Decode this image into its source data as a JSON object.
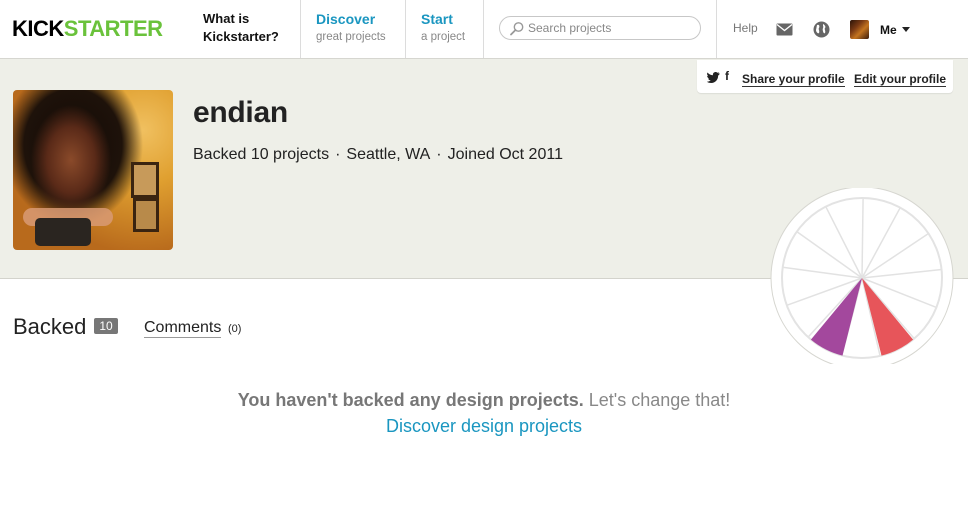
{
  "nav": {
    "logo_part1": "KICK",
    "logo_part2": "STARTER",
    "what_line1": "What is",
    "what_line2": "Kickstarter?",
    "discover_main": "Discover",
    "discover_sub": "great projects",
    "start_main": "Start",
    "start_sub": "a project",
    "search_placeholder": "Search projects",
    "help": "Help",
    "me": "Me",
    "icons": [
      "search-icon",
      "mail-icon",
      "globe-icon",
      "chevron-down-icon"
    ]
  },
  "share": {
    "share_profile": "Share your profile",
    "edit_profile": "Edit your profile",
    "icons": [
      "twitter-icon",
      "facebook-icon"
    ],
    "facebook_glyph": "f"
  },
  "profile": {
    "name": "endian",
    "backed": "Backed 10 projects",
    "location": "Seattle, WA",
    "joined": "Joined Oct 2011",
    "separator": "·"
  },
  "tabs": {
    "backed_label": "Backed",
    "backed_count": "10",
    "comments_label": "Comments",
    "comments_count": "(0)"
  },
  "empty_state": {
    "bold_text": "You haven't backed any design projects.",
    "rest_text": "Let's change that!",
    "link_text": "Discover design projects"
  },
  "colors": {
    "brand_green": "#6ac23b",
    "link_blue": "#1a96c0",
    "band_background": "#eeefe8",
    "wheel_purple": "#a3489d",
    "wheel_red": "#e7555a"
  }
}
